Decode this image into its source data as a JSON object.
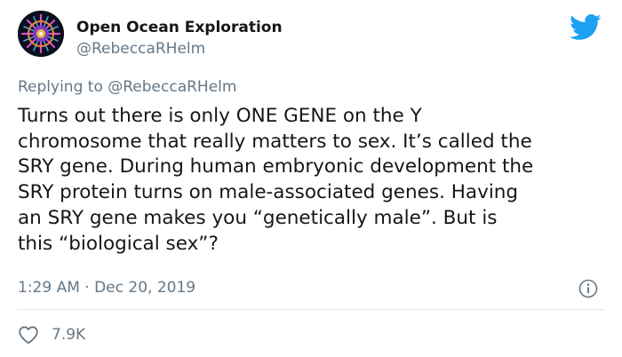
{
  "account": {
    "display_name": "Open Ocean Exploration",
    "handle": "@RebeccaRHelm",
    "avatar_icon": "jellyfish-avatar"
  },
  "brand": {
    "icon": "twitter-bird-icon",
    "color": "#1da1f2"
  },
  "reply": {
    "prefix": "Replying to",
    "mention": "@RebeccaRHelm"
  },
  "tweet": {
    "lines": [
      "Turns out there is only ONE GENE on the Y",
      "chromosome that really matters to sex. It’s called the",
      "SRY gene. During human embryonic development the",
      "SRY protein turns on male-associated genes. Having",
      "an SRY gene makes you “genetically male”. But is",
      "this “biological sex”?"
    ]
  },
  "meta": {
    "timestamp": "1:29 AM · Dec 20, 2019",
    "info_icon": "info-icon"
  },
  "actions": {
    "like_icon": "heart-icon",
    "like_count": "7.9K"
  },
  "colors": {
    "text": "#14171a",
    "secondary": "#657786",
    "divider": "#e1e8ed"
  }
}
